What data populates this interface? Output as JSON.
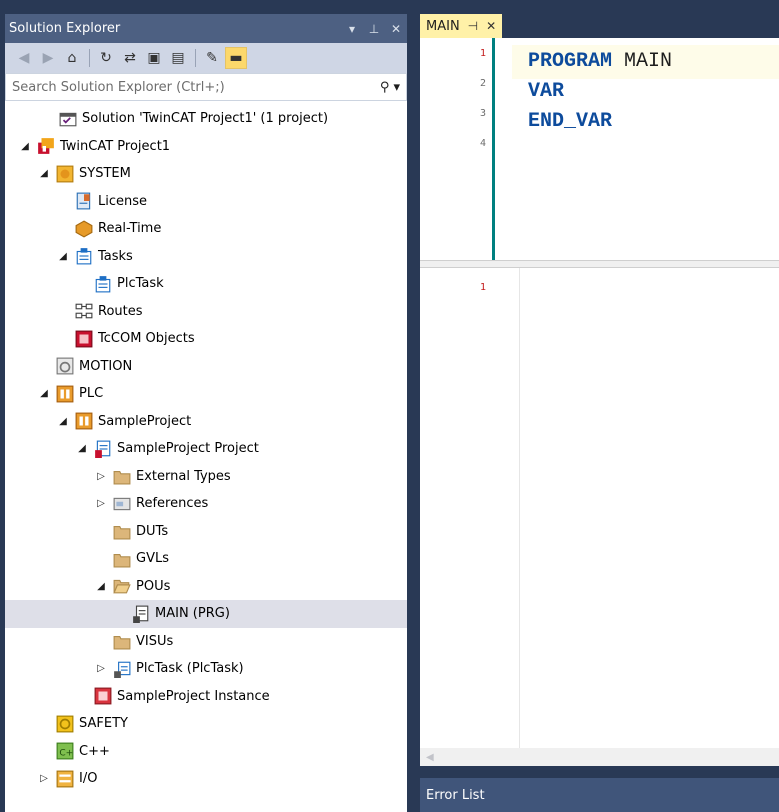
{
  "solution_explorer": {
    "title": "Solution Explorer",
    "controls": [
      "▾",
      "⊥",
      "✕"
    ],
    "search_placeholder": "Search Solution Explorer (Ctrl+;)",
    "tree": [
      {
        "label": "Solution 'TwinCAT Project1' (1 project)",
        "icon": "solution-icon",
        "depth": 0,
        "exp": ""
      },
      {
        "label": "TwinCAT Project1",
        "icon": "twincat-project-icon",
        "depth": 0,
        "exp": "▲"
      },
      {
        "label": "SYSTEM",
        "icon": "system-icon",
        "depth": 1,
        "exp": "▲"
      },
      {
        "label": "License",
        "icon": "license-icon",
        "depth": 2,
        "exp": ""
      },
      {
        "label": "Real-Time",
        "icon": "realtime-icon",
        "depth": 2,
        "exp": ""
      },
      {
        "label": "Tasks",
        "icon": "tasks-icon",
        "depth": 2,
        "exp": "▲"
      },
      {
        "label": "PlcTask",
        "icon": "task-icon",
        "depth": 3,
        "exp": ""
      },
      {
        "label": "Routes",
        "icon": "routes-icon",
        "depth": 2,
        "exp": ""
      },
      {
        "label": "TcCOM Objects",
        "icon": "tccom-icon",
        "depth": 2,
        "exp": ""
      },
      {
        "label": "MOTION",
        "icon": "motion-icon",
        "depth": 1,
        "exp": ""
      },
      {
        "label": "PLC",
        "icon": "plc-icon",
        "depth": 1,
        "exp": "▲"
      },
      {
        "label": "SampleProject",
        "icon": "plc-project-icon",
        "depth": 2,
        "exp": "▲"
      },
      {
        "label": "SampleProject Project",
        "icon": "plc-project-file-icon",
        "depth": 3,
        "exp": "▲"
      },
      {
        "label": "External Types",
        "icon": "folder-icon",
        "depth": 4,
        "exp": "▷"
      },
      {
        "label": "References",
        "icon": "references-icon",
        "depth": 4,
        "exp": "▷"
      },
      {
        "label": "DUTs",
        "icon": "folder-icon",
        "depth": 4,
        "exp": ""
      },
      {
        "label": "GVLs",
        "icon": "folder-icon",
        "depth": 4,
        "exp": ""
      },
      {
        "label": "POUs",
        "icon": "folder-open-icon",
        "depth": 4,
        "exp": "▲"
      },
      {
        "label": "MAIN (PRG)",
        "icon": "pou-icon",
        "depth": 5,
        "exp": "",
        "selected": true
      },
      {
        "label": "VISUs",
        "icon": "folder-icon",
        "depth": 4,
        "exp": ""
      },
      {
        "label": "PlcTask (PlcTask)",
        "icon": "task-ref-icon",
        "depth": 4,
        "exp": "▷"
      },
      {
        "label": "SampleProject Instance",
        "icon": "instance-icon",
        "depth": 3,
        "exp": ""
      },
      {
        "label": "SAFETY",
        "icon": "safety-icon",
        "depth": 1,
        "exp": ""
      },
      {
        "label": "C++",
        "icon": "cpp-icon",
        "depth": 1,
        "exp": ""
      },
      {
        "label": "I/O",
        "icon": "io-icon",
        "depth": 1,
        "exp": "▷"
      }
    ]
  },
  "editor": {
    "tab_label": "MAIN",
    "tab_pin": "⊣",
    "tab_close": "✕",
    "declaration_lines": [
      {
        "num": "1",
        "tokens": [
          {
            "t": "PROGRAM ",
            "c": "kw"
          },
          {
            "t": "MAIN",
            "c": "id"
          }
        ]
      },
      {
        "num": "2",
        "tokens": [
          {
            "t": "VAR",
            "c": "kw"
          }
        ]
      },
      {
        "num": "3",
        "tokens": [
          {
            "t": "END_VAR",
            "c": "kw"
          }
        ]
      },
      {
        "num": "4",
        "tokens": []
      }
    ],
    "implementation_lines": [
      {
        "num": "1"
      }
    ]
  },
  "error_list": {
    "title": "Error List"
  },
  "colors": {
    "accent": "#293955",
    "tab_active": "#fff1a8",
    "keyword": "#0d4b9c",
    "gutter_bar": "#008080"
  }
}
